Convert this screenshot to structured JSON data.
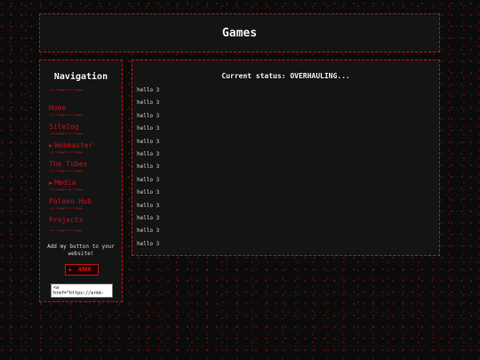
{
  "header": {
    "title": "Games"
  },
  "sidebar": {
    "title": "Navigation",
    "divider_glyphs": "·•·~∗✣∗~·•·~∗✣∗",
    "links": [
      {
        "label": "Home",
        "arrow": ""
      },
      {
        "label": "Sitelog",
        "arrow": ""
      },
      {
        "label": "Webmaster",
        "arrow": "▶"
      },
      {
        "label": "The Tubes",
        "arrow": ""
      },
      {
        "label": "Media",
        "arrow": "▶"
      },
      {
        "label": "Palaeo Hub",
        "arrow": ""
      },
      {
        "label": "Projects",
        "arrow": ""
      }
    ],
    "promo_text": "Add my button to your website!",
    "badge_text": "ARKK",
    "code_value": "<a\nhref=\"https://arkk-"
  },
  "main": {
    "status": "Current status: OVERHAULING...",
    "lines": [
      "hello 3",
      "hello 3",
      "hello 3",
      "hello 3",
      "hello 3",
      "hello 3",
      "hello 3",
      "hello 3",
      "hello 3",
      "hello 3",
      "hello 3",
      "hello 3",
      "hello 3"
    ]
  },
  "colors": {
    "accent": "#c0141a",
    "background": "#0b0b0b",
    "panel": "#141414",
    "text": "#f2f2f2"
  }
}
